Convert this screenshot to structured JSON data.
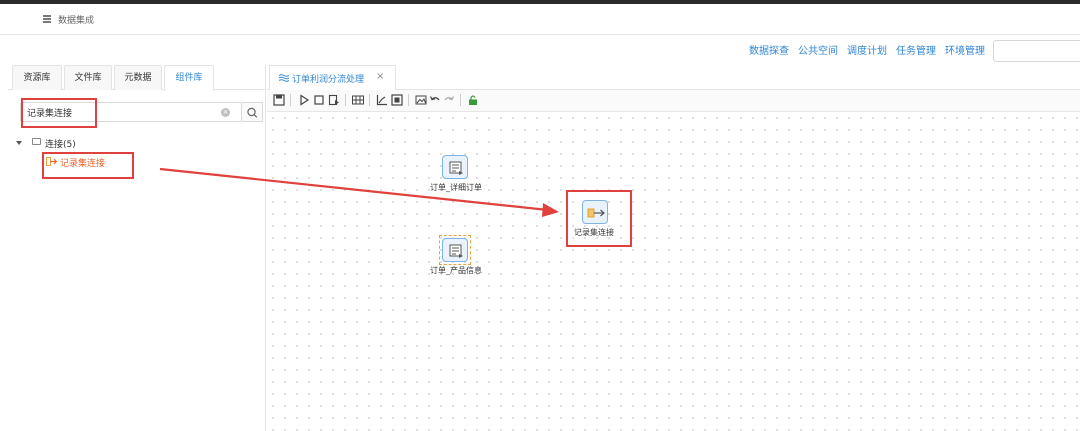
{
  "app": {
    "title": "数据集成"
  },
  "top_nav": {
    "items": [
      "数据探查",
      "公共空间",
      "调度计划",
      "任务管理",
      "环境管理"
    ],
    "search_placeholder": ""
  },
  "left_panel": {
    "tabs": [
      {
        "label": "资源库",
        "active": false
      },
      {
        "label": "文件库",
        "active": false
      },
      {
        "label": "元数据",
        "active": false
      },
      {
        "label": "组件库",
        "active": true
      }
    ],
    "search": {
      "value": "记录集连接",
      "placeholder": ""
    },
    "tree": {
      "folder_label": "连接(5)",
      "leaf_label": "记录集连接"
    }
  },
  "editor": {
    "tab_label": "订单利润分流处理",
    "tab_close": "×",
    "toolbar_icons": [
      "save-icon",
      "run-icon",
      "stop-icon",
      "debug-icon",
      "grid-icon",
      "chart-icon",
      "layout-icon",
      "image-icon",
      "undo-icon",
      "redo-icon",
      "lock-icon"
    ]
  },
  "canvas": {
    "nodes": [
      {
        "label": "订单_详细订单",
        "icon": "table-input-icon"
      },
      {
        "label": "订单_产品信息",
        "icon": "table-input-icon",
        "selected": true
      },
      {
        "label": "记录集连接",
        "icon": "record-join-icon"
      }
    ]
  },
  "colors": {
    "accent": "#2f86d6",
    "highlight": "#e0413c",
    "tree_leaf": "#e8632a",
    "node_border": "#7fb2e6"
  }
}
